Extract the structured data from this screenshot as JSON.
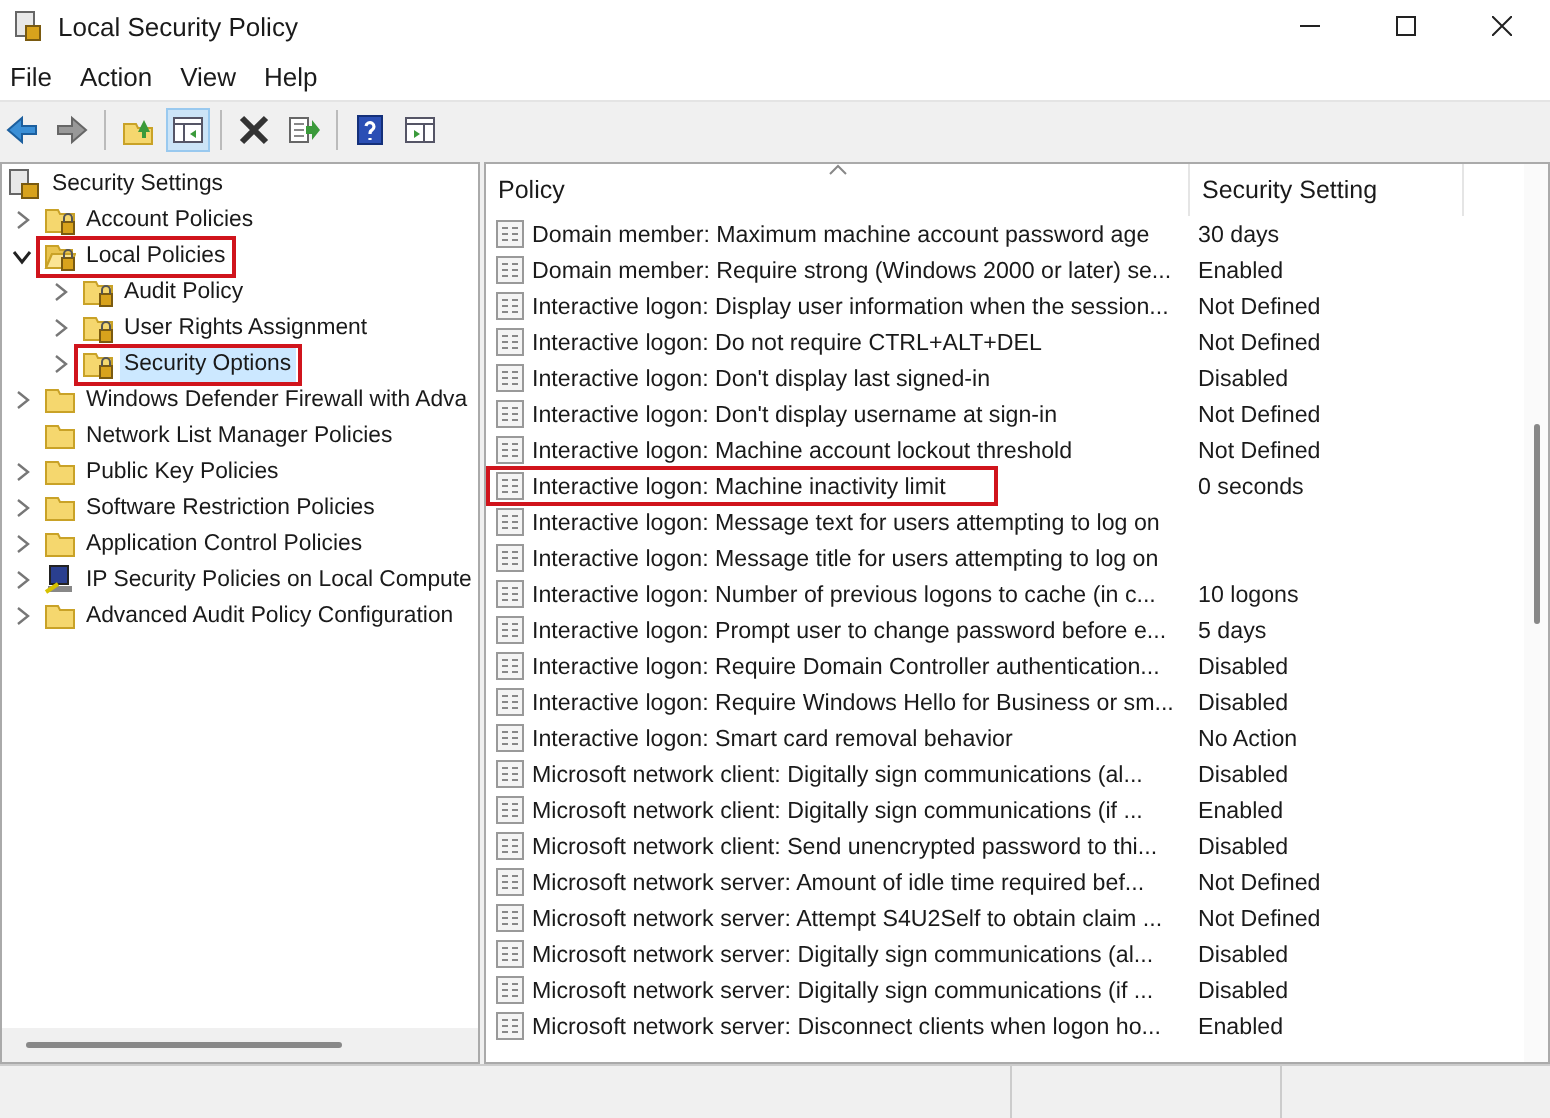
{
  "window": {
    "title": "Local Security Policy"
  },
  "menu": [
    "File",
    "Action",
    "View",
    "Help"
  ],
  "toolbar": [
    {
      "kind": "back",
      "pressed": false
    },
    {
      "kind": "forward",
      "pressed": false
    },
    {
      "kind": "sep"
    },
    {
      "kind": "up",
      "pressed": false
    },
    {
      "kind": "tree",
      "pressed": true
    },
    {
      "kind": "sep"
    },
    {
      "kind": "delete",
      "pressed": false
    },
    {
      "kind": "export",
      "pressed": false
    },
    {
      "kind": "sep"
    },
    {
      "kind": "help",
      "pressed": false
    },
    {
      "kind": "panel",
      "pressed": false
    }
  ],
  "tree": {
    "root": {
      "label": "Security Settings"
    },
    "items": [
      {
        "label": "Account Policies",
        "kind": "lockfolder",
        "expandable": true,
        "expanded": false,
        "selected": false,
        "highlighted": false
      },
      {
        "label": "Local Policies",
        "kind": "lockfolder",
        "expandable": true,
        "expanded": true,
        "selected": false,
        "highlighted": true,
        "children": [
          {
            "label": "Audit Policy",
            "kind": "lockfolder",
            "expandable": true,
            "expanded": false,
            "selected": false,
            "highlighted": false
          },
          {
            "label": "User Rights Assignment",
            "kind": "lockfolder",
            "expandable": true,
            "expanded": false,
            "selected": false,
            "highlighted": false
          },
          {
            "label": "Security Options",
            "kind": "lockfolder",
            "expandable": true,
            "expanded": false,
            "selected": true,
            "highlighted": true
          }
        ]
      },
      {
        "label": "Windows Defender Firewall with Adva",
        "kind": "folder",
        "expandable": true,
        "expanded": false,
        "selected": false,
        "highlighted": false
      },
      {
        "label": "Network List Manager Policies",
        "kind": "folder",
        "expandable": false,
        "selected": false,
        "highlighted": false
      },
      {
        "label": "Public Key Policies",
        "kind": "folder",
        "expandable": true,
        "expanded": false,
        "selected": false,
        "highlighted": false
      },
      {
        "label": "Software Restriction Policies",
        "kind": "folder",
        "expandable": true,
        "expanded": false,
        "selected": false,
        "highlighted": false
      },
      {
        "label": "Application Control Policies",
        "kind": "folder",
        "expandable": true,
        "expanded": false,
        "selected": false,
        "highlighted": false
      },
      {
        "label": "IP Security Policies on Local Compute",
        "kind": "computer",
        "expandable": true,
        "expanded": false,
        "selected": false,
        "highlighted": false
      },
      {
        "label": "Advanced Audit Policy Configuration",
        "kind": "folder",
        "expandable": true,
        "expanded": false,
        "selected": false,
        "highlighted": false
      }
    ]
  },
  "table": {
    "columns": [
      "Policy",
      "Security Setting"
    ],
    "rows": [
      {
        "policy": "Domain member: Maximum machine account password age",
        "setting": "30 days",
        "highlighted": false
      },
      {
        "policy": "Domain member: Require strong (Windows 2000 or later) se...",
        "setting": "Enabled",
        "highlighted": false
      },
      {
        "policy": "Interactive logon: Display user information when the session...",
        "setting": "Not Defined",
        "highlighted": false
      },
      {
        "policy": "Interactive logon: Do not require CTRL+ALT+DEL",
        "setting": "Not Defined",
        "highlighted": false
      },
      {
        "policy": "Interactive logon: Don't display last signed-in",
        "setting": "Disabled",
        "highlighted": false
      },
      {
        "policy": "Interactive logon: Don't display username at sign-in",
        "setting": "Not Defined",
        "highlighted": false
      },
      {
        "policy": "Interactive logon: Machine account lockout threshold",
        "setting": "Not Defined",
        "highlighted": false
      },
      {
        "policy": "Interactive logon: Machine inactivity limit",
        "setting": "0 seconds",
        "highlighted": true
      },
      {
        "policy": "Interactive logon: Message text for users attempting to log on",
        "highlighted": false
      },
      {
        "policy": "Interactive logon: Message title for users attempting to log on",
        "highlighted": false
      },
      {
        "policy": "Interactive logon: Number of previous logons to cache (in c...",
        "setting": "10 logons",
        "highlighted": false
      },
      {
        "policy": "Interactive logon: Prompt user to change password before e...",
        "setting": "5 days",
        "highlighted": false
      },
      {
        "policy": "Interactive logon: Require Domain Controller authentication...",
        "setting": "Disabled",
        "highlighted": false
      },
      {
        "policy": "Interactive logon: Require Windows Hello for Business or sm...",
        "setting": "Disabled",
        "highlighted": false
      },
      {
        "policy": "Interactive logon: Smart card removal behavior",
        "setting": "No Action",
        "highlighted": false
      },
      {
        "policy": "Microsoft network client: Digitally sign communications (al...",
        "setting": "Disabled",
        "highlighted": false
      },
      {
        "policy": "Microsoft network client: Digitally sign communications (if ...",
        "setting": "Enabled",
        "highlighted": false
      },
      {
        "policy": "Microsoft network client: Send unencrypted password to thi...",
        "setting": "Disabled",
        "highlighted": false
      },
      {
        "policy": "Microsoft network server: Amount of idle time required bef...",
        "setting": "Not Defined",
        "highlighted": false
      },
      {
        "policy": "Microsoft network server: Attempt S4U2Self to obtain claim ...",
        "setting": "Not Defined",
        "highlighted": false
      },
      {
        "policy": "Microsoft network server: Digitally sign communications (al...",
        "setting": "Disabled",
        "highlighted": false
      },
      {
        "policy": "Microsoft network server: Digitally sign communications (if ...",
        "setting": "Disabled",
        "highlighted": false
      },
      {
        "policy": "Microsoft network server: Disconnect clients when logon ho...",
        "setting": "Enabled",
        "highlighted": false
      }
    ]
  }
}
